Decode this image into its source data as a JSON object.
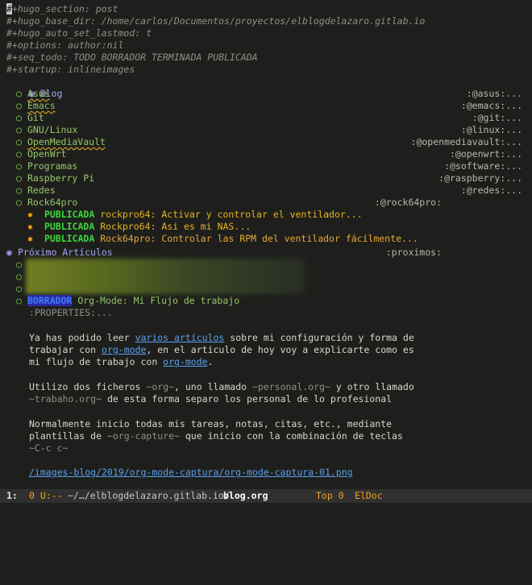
{
  "header_lines": [
    {
      "cursor": "#",
      "rest": "+hugo_section: post"
    },
    {
      "cursor": "",
      "rest": "#+hugo_base_dir: /home/carlos/Documentos/proyectos/elblogdelazaro.gitlab.io"
    },
    {
      "cursor": "",
      "rest": "#+hugo_auto_set_lastmod: t"
    },
    {
      "cursor": "",
      "rest": "#+options: author:nil"
    },
    {
      "cursor": "",
      "rest": "#+seq_todo: TODO BORRADOR TERMINADA PUBLICADA"
    },
    {
      "cursor": "",
      "rest": "#+startup: inlineimages"
    }
  ],
  "level1_bullet": "◉",
  "level2_bullet": "○",
  "level3_bullet": "✸",
  "blog": {
    "title": "Blog"
  },
  "categories": [
    {
      "title": "Asus",
      "tag": ":@asus:..."
    },
    {
      "title": "Emacs",
      "tag": ":@emacs:..."
    },
    {
      "title": "Git",
      "tag": ":@git:..."
    },
    {
      "title": "GNU/Linux",
      "tag": ":@linux:..."
    },
    {
      "title": "OpenMediaVault",
      "tag": ":@openmediavault:..."
    },
    {
      "title": "OpenWrt",
      "tag": ":@openwrt:..."
    },
    {
      "title": "Programas",
      "tag": ":@software:..."
    },
    {
      "title": "Raspberry Pi",
      "tag": ":@raspberry:..."
    },
    {
      "title": "Redes",
      "tag": ":@redes:..."
    },
    {
      "title": "Rock64pro",
      "tag": ":@rock64pro:"
    }
  ],
  "rock_posts": [
    {
      "keyword": "PUBLICADA",
      "title": "rockpro64: Activar y controlar el ventilador..."
    },
    {
      "keyword": "PUBLICADA",
      "title": "Rockpro64: Asi es mi NAS..."
    },
    {
      "keyword": "PUBLICADA",
      "title": "Rock64pro: Controlar las RPM del ventilador fácilmente..."
    }
  ],
  "proximos": {
    "title": "Próximo Artículos",
    "tag": ":proximos:"
  },
  "current_post": {
    "keyword": "BORRADOR",
    "title": "Org-Mode: Mi Flujo de trabajo",
    "properties": ":PROPERTIES:..."
  },
  "para1": {
    "l1_a": "Ya has podido leer ",
    "l1_link": "varios artículos",
    "l1_b": " sobre mi configuración y forma de",
    "l2_a": "trabajar con ",
    "l2_link": "org-mode",
    "l2_b": ", en el articulo de hoy voy a explicarte como es",
    "l3_a": "mi flujo de trabajo con ",
    "l3_link": "org-mode",
    "l3_b": "."
  },
  "para2": {
    "l1_a": "Utilizo dos ficheros ",
    "l1_c1": "~org~",
    "l1_b": ", uno llamado ",
    "l1_c2": "~personal.org~",
    "l1_d": " y otro llamado",
    "l2_c": "~trabaho.org~",
    "l2_b": " de esta forma separo los personal de lo profesional"
  },
  "para3": {
    "l1": "Normalmente inicio todas mis tareas, notas, citas, etc., mediante",
    "l2_a": "plantillas de ",
    "l2_c": "~org-capture~",
    "l2_b": " que inicio con la combinación de teclas",
    "l3_c": "~C-c c~"
  },
  "image_link": "/images-blog/2019/org-mode-captura/org-mode-captura-01.png",
  "modeline": {
    "window_number": "1:",
    "state": "0 U:--",
    "path": "~/…/elblogdelazaro.gitlab.io/",
    "file": "blog.org",
    "position": "Top 0",
    "minor_mode": "ElDoc"
  },
  "colors": {
    "background": "#1e1f1c",
    "keyword_done": "#3ed63e",
    "keyword_draft": "#3f7bff",
    "accent": "#f0a020"
  }
}
